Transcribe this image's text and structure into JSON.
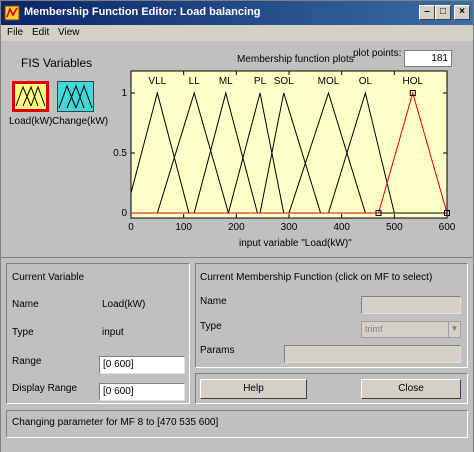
{
  "window": {
    "title": "Membership Function Editor: Load balancing"
  },
  "menu": {
    "items": [
      "File",
      "Edit",
      "View"
    ]
  },
  "fis": {
    "title": "FIS Variables",
    "variables": [
      {
        "name": "Load(kW)"
      },
      {
        "name": "Change(kW)"
      }
    ]
  },
  "plot": {
    "header": "Membership function plots",
    "plot_points_label": "plot points:",
    "plot_points_value": "181",
    "xlabel": "input variable \"Load(kW)\""
  },
  "chart_data": {
    "type": "line",
    "xlabel": "input variable \"Load(kW)\"",
    "xlim": [
      0,
      600
    ],
    "ylim": [
      0,
      1
    ],
    "x_ticks": [
      0,
      100,
      200,
      300,
      400,
      500,
      600
    ],
    "y_ticks": [
      0,
      0.5,
      1
    ],
    "colors": {
      "background": "#ffffc8",
      "line": "#000000",
      "selected": "#e00000"
    },
    "series": [
      {
        "name": "VLL",
        "params": [
          -10,
          50,
          110
        ]
      },
      {
        "name": "LL",
        "params": [
          50,
          120,
          185
        ]
      },
      {
        "name": "ML",
        "params": [
          120,
          180,
          240
        ]
      },
      {
        "name": "PL",
        "params": [
          185,
          245,
          290
        ]
      },
      {
        "name": "SOL",
        "params": [
          245,
          290,
          360
        ]
      },
      {
        "name": "MOL",
        "params": [
          300,
          375,
          445
        ]
      },
      {
        "name": "OL",
        "params": [
          375,
          445,
          500
        ]
      },
      {
        "name": "HOL",
        "params": [
          470,
          535,
          600
        ]
      }
    ],
    "selected_index": 7
  },
  "current_variable": {
    "header": "Current Variable",
    "name_label": "Name",
    "name_value": "Load(kW)",
    "type_label": "Type",
    "type_value": "input",
    "range_label": "Range",
    "range_value": "[0 600]",
    "display_range_label": "Display Range",
    "display_range_value": "[0 600]"
  },
  "current_mf": {
    "header": "Current Membership Function (click on MF to select)",
    "name_label": "Name",
    "name_value": "",
    "type_label": "Type",
    "type_value": "trimf",
    "params_label": "Params",
    "params_value": ""
  },
  "buttons": {
    "help": "Help",
    "close": "Close"
  },
  "status": {
    "text": "Changing parameter for MF 8 to  [470 535 600]"
  }
}
